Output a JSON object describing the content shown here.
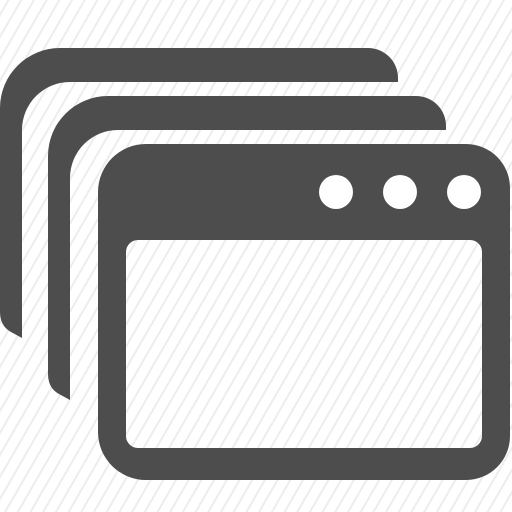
{
  "icon": {
    "name": "multiple-windows-icon",
    "color": "#4d4d4d",
    "window_control_dot_count": 3
  }
}
